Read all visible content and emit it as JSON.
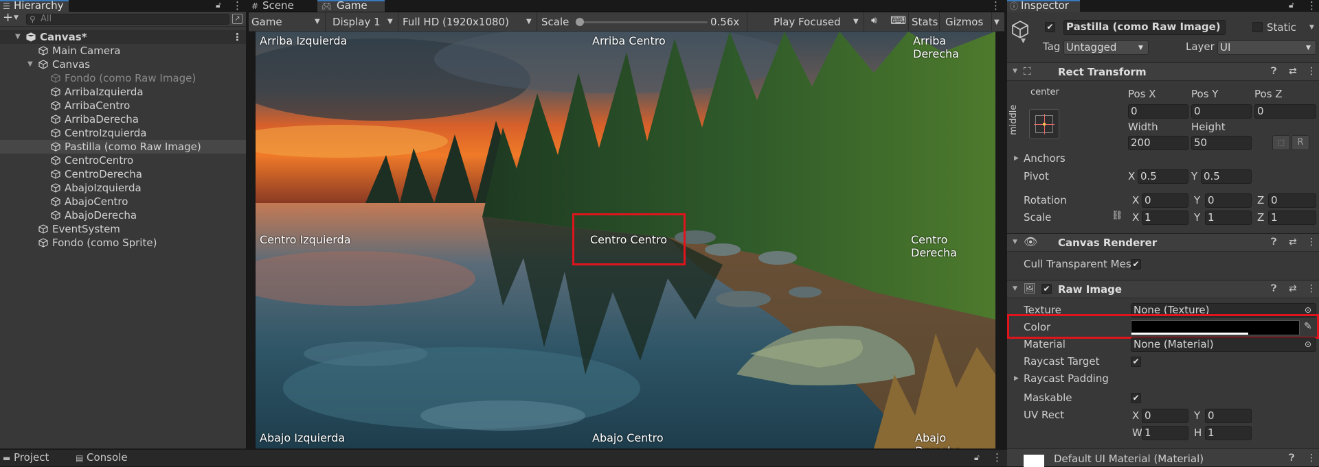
{
  "hierarchy": {
    "tab_label": "Hierarchy",
    "search_placeholder": "All",
    "rows": [
      {
        "label": "Canvas*"
      },
      {
        "label": "Main Camera"
      },
      {
        "label": "Canvas"
      },
      {
        "label": "Fondo (como Raw Image)"
      },
      {
        "label": "ArribaIzquierda"
      },
      {
        "label": "ArribaCentro"
      },
      {
        "label": "ArribaDerecha"
      },
      {
        "label": "CentroIzquierda"
      },
      {
        "label": "Pastilla (como Raw Image)"
      },
      {
        "label": "CentroCentro"
      },
      {
        "label": "CentroDerecha"
      },
      {
        "label": "AbajoIzquierda"
      },
      {
        "label": "AbajoCentro"
      },
      {
        "label": "AbajoDerecha"
      },
      {
        "label": "EventSystem"
      },
      {
        "label": "Fondo (como Sprite)"
      }
    ]
  },
  "view_tabs": {
    "scene": "Scene",
    "game": "Game"
  },
  "game_toolbar": {
    "mode": "Game",
    "display": "Display 1",
    "resolution": "Full HD (1920x1080)",
    "scale_label": "Scale",
    "scale_value": "0.56x",
    "scale_fraction": 0.0,
    "play_mode": "Play Focused",
    "stats": "Stats",
    "gizmos": "Gizmos"
  },
  "game_view": {
    "top_left": "Arriba Izquierda",
    "top_center": "Arriba Centro",
    "top_right": "Arriba Derecha",
    "mid_left": "Centro Izquierda",
    "mid_center": "Centro Centro",
    "mid_right": "Centro Derecha",
    "bottom_left": "Abajo Izquierda",
    "bottom_center": "Abajo Centro",
    "bottom_right": "Abajo Derecha"
  },
  "bottom_tabs": {
    "project": "Project",
    "console": "Console"
  },
  "inspector": {
    "tab_label": "Inspector",
    "object_name": "Pastilla (como Raw Image)",
    "static_label": "Static",
    "tag_label": "Tag",
    "tag_value": "Untagged",
    "layer_label": "Layer",
    "layer_value": "UI",
    "rect_transform": {
      "title": "Rect Transform",
      "anchor_h": "center",
      "anchor_v": "middle",
      "posx_label": "Pos X",
      "posx": "0",
      "posy_label": "Pos Y",
      "posy": "0",
      "posz_label": "Pos Z",
      "posz": "0",
      "width_label": "Width",
      "width": "200",
      "height_label": "Height",
      "height": "50",
      "r_button": "R",
      "anchors_label": "Anchors",
      "pivot_label": "Pivot",
      "pivot_x": "0.5",
      "pivot_y": "0.5",
      "rotation_label": "Rotation",
      "rot_x": "0",
      "rot_y": "0",
      "rot_z": "0",
      "scale_label": "Scale",
      "scale_x": "1",
      "scale_y": "1",
      "scale_z": "1",
      "x": "X",
      "y": "Y",
      "z": "Z"
    },
    "canvas_renderer": {
      "title": "Canvas Renderer",
      "cull_label": "Cull Transparent Mes"
    },
    "raw_image": {
      "title": "Raw Image",
      "texture_label": "Texture",
      "texture_value": "None (Texture)",
      "color_label": "Color",
      "color_value": "#000000",
      "material_label": "Material",
      "material_value": "None (Material)",
      "raycast_target_label": "Raycast Target",
      "raycast_padding_label": "Raycast Padding",
      "maskable_label": "Maskable",
      "uvrect_label": "UV Rect",
      "uv_x": "0",
      "uv_y": "0",
      "uv_w": "1",
      "uv_h": "1",
      "w": "W",
      "h": "H"
    },
    "material_footer": "Default UI Material (Material)"
  },
  "colors": {
    "accent": "#3a79bb",
    "highlight_box": "#e0141c"
  }
}
